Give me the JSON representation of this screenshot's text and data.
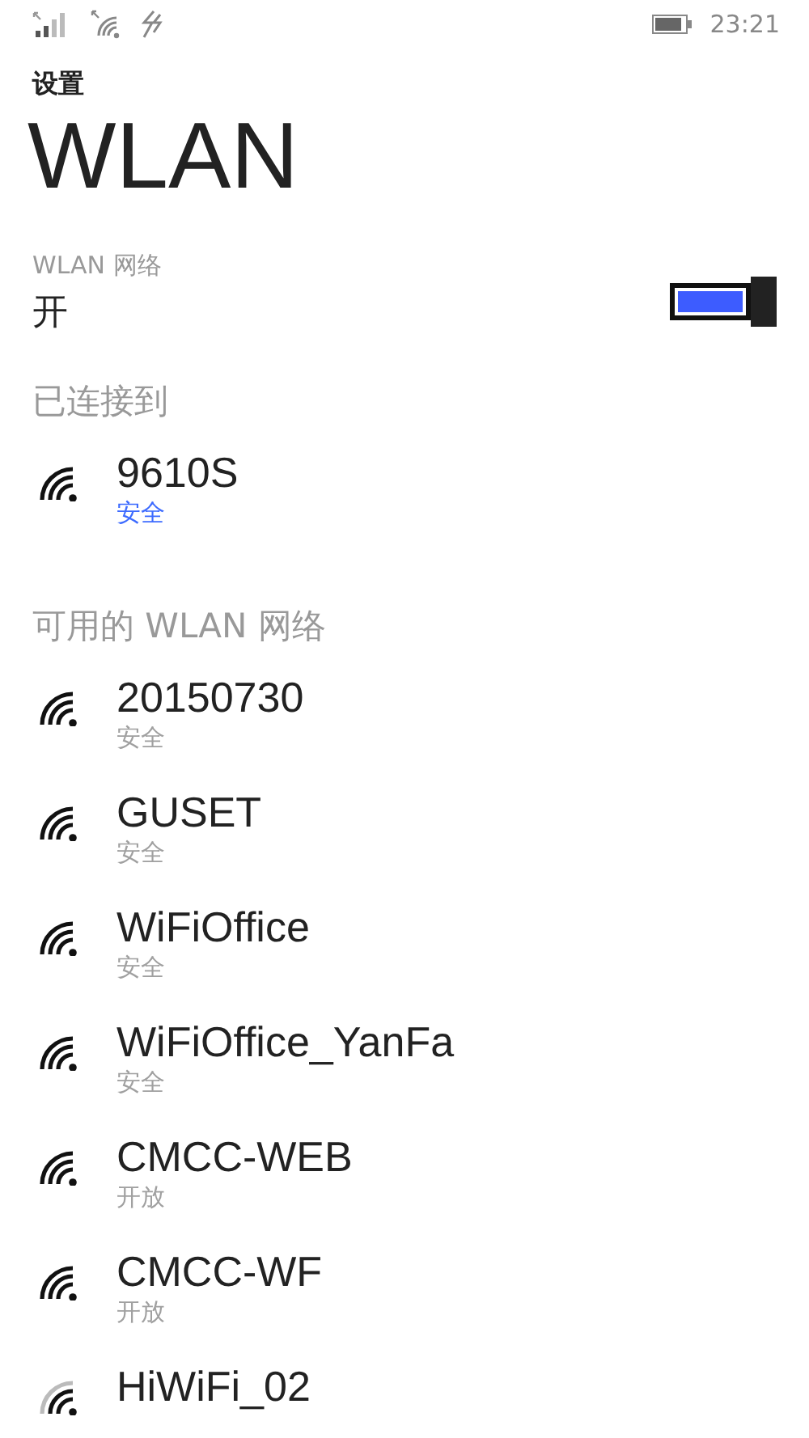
{
  "status_bar": {
    "time": "23:21"
  },
  "header": {
    "app": "设置",
    "title": "WLAN"
  },
  "wlan_toggle": {
    "label": "WLAN 网络",
    "value": "开",
    "on": true
  },
  "connected": {
    "heading": "已连接到",
    "networks": [
      {
        "name": "9610S",
        "security": "安全",
        "color": "#3d6bff",
        "strong": true
      }
    ]
  },
  "available": {
    "heading": "可用的 WLAN 网络",
    "networks": [
      {
        "name": "20150730",
        "security": "安全",
        "color": "#a0a0a0",
        "strong": true
      },
      {
        "name": "GUSET",
        "security": "安全",
        "color": "#a0a0a0",
        "strong": true
      },
      {
        "name": "WiFiOffice",
        "security": "安全",
        "color": "#a0a0a0",
        "strong": true
      },
      {
        "name": "WiFiOffice_YanFa",
        "security": "安全",
        "color": "#a0a0a0",
        "strong": true
      },
      {
        "name": "CMCC-WEB",
        "security": "开放",
        "color": "#a0a0a0",
        "strong": true
      },
      {
        "name": "CMCC-WF",
        "security": "开放",
        "color": "#a0a0a0",
        "strong": true
      },
      {
        "name": "HiWiFi_02",
        "strong": false
      }
    ]
  }
}
